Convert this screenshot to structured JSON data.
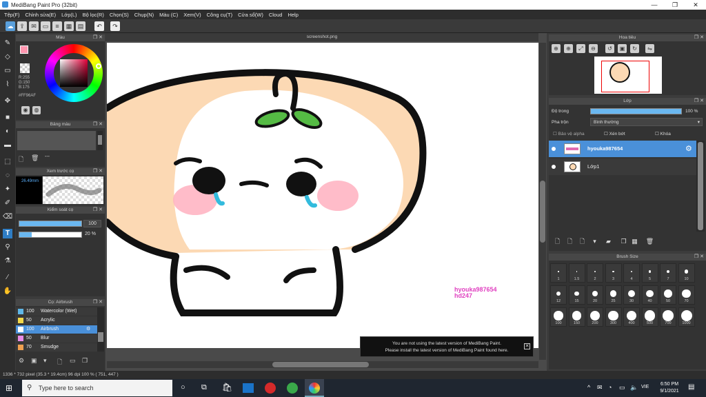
{
  "window": {
    "title": "MediBang Paint Pro (32bit)"
  },
  "menu": [
    "Tệp(F)",
    "Chỉnh sửa(E)",
    "Lớp(L)",
    "Bộ lọc(R)",
    "Chọn(S)",
    "Chụp(N)",
    "Màu (C)",
    "Xem(V)",
    "Công cụ(T)",
    "Cửa sổ(W)",
    "Cloud",
    "Help"
  ],
  "color_panel": {
    "title": "Màu",
    "rgb": "R:255\nG:150\nB:175",
    "r": "R:255",
    "g": "G:150",
    "b": "B:175",
    "hex": "#FF96AF",
    "fg": "#ff96af"
  },
  "palette_panel": {
    "title": "Bảng màu",
    "item": "---"
  },
  "brush_preview": {
    "title": "Xem trước cọ",
    "size": "26.49mm"
  },
  "brush_control": {
    "title": "Kiểm soát cọ",
    "size_value": "100",
    "opacity_value": "20 %"
  },
  "brush_list": {
    "title": "Cọ: Airbrush",
    "items": [
      {
        "size": "100",
        "name": "Watercolor (Wet)",
        "color": "#5fb7e8"
      },
      {
        "size": "50",
        "name": "Acrylic",
        "color": "#f2d84a"
      },
      {
        "size": "100",
        "name": "Airbrush",
        "color": "#ffffff"
      },
      {
        "size": "50",
        "name": "Blur",
        "color": "#e98be8"
      },
      {
        "size": "70",
        "name": "Smudge",
        "color": "#f0a050"
      }
    ]
  },
  "document": {
    "tab": "screenshot.png",
    "watermark_1": "hyouka987654",
    "watermark_2": "hd247"
  },
  "navigator": {
    "title": "Hoa tiêu"
  },
  "layer_panel": {
    "title": "Lớp",
    "opacity_label": "Độ trong",
    "opacity_value": "100 %",
    "blend_label": "Pha trộn",
    "blend_value": "Bình thường",
    "protect_alpha": "Bảo vệ alpha",
    "clipping": "Xén bớt",
    "lock": "Khóa",
    "layers": [
      {
        "name": "hyouka987654",
        "selected": true
      },
      {
        "name": "Lớp1",
        "selected": false
      }
    ]
  },
  "brush_size": {
    "title": "Brush Size",
    "sizes": [
      "1",
      "1.5",
      "2",
      "3",
      "4",
      "5",
      "7",
      "10",
      "12",
      "15",
      "20",
      "25",
      "30",
      "40",
      "50",
      "70",
      "100",
      "150",
      "200",
      "300",
      "400",
      "500",
      "700",
      "1000"
    ]
  },
  "notification": {
    "line1": "You are not using the latest version of MediBang Paint.",
    "line2": "Please install the latest version of MediBang Paint found here."
  },
  "status": {
    "text": "1336 * 732 pixel  (35.3 * 19.4cm)  96 dpi  100 %  ( 751, 447 )"
  },
  "taskbar": {
    "search_placeholder": "Type here to search",
    "lang": "VIE",
    "time": "6:50 PM",
    "date": "9/1/2021"
  }
}
